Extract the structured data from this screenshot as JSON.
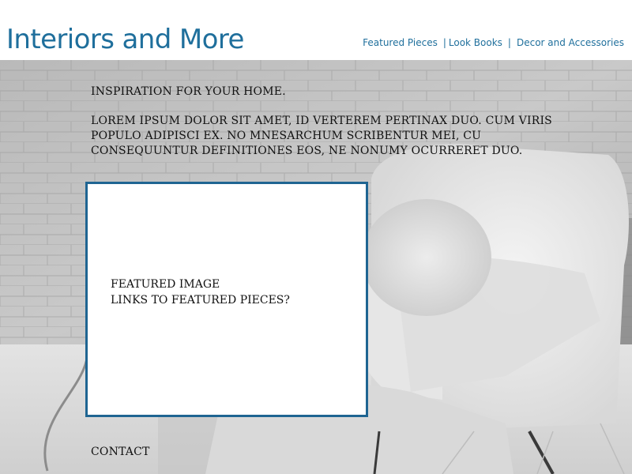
{
  "header": {
    "site_title": "Interiors and More",
    "nav": {
      "items": [
        "Featured Pieces",
        "Look Books",
        "Decor and Accessories"
      ],
      "separator": "|"
    }
  },
  "main": {
    "tagline": "Inspiration for your home.",
    "intro": "Lorem ipsum dolor sit amet, id verterem pertinax duo. Cum viris populo adipisci ex. No mnesarchum scribentur mei, cu consequuntur definitiones eos, ne nonumy ocurreret duo.",
    "featured": {
      "line1": "Featured image",
      "line2": "Links to featured pieces?"
    },
    "contact": "Contact"
  },
  "colors": {
    "accent": "#1f6f9c",
    "box_border": "#1f6592",
    "text": "#111111"
  }
}
